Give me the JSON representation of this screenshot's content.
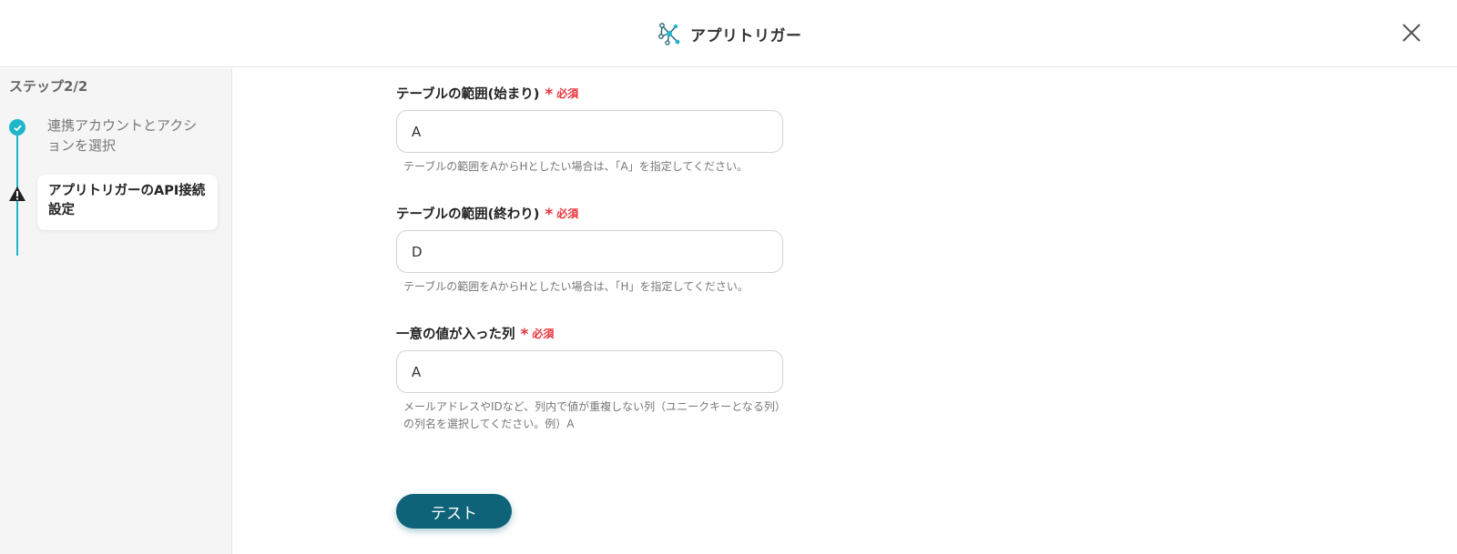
{
  "header": {
    "title": "アプリトリガー",
    "logo_icon": "network-nodes-icon",
    "close_icon": "close-icon"
  },
  "sidebar": {
    "step_counter": "ステップ2/2",
    "steps": [
      {
        "label": "連携アカウントとアクションを選択",
        "status": "completed",
        "icon": "check-circle-icon"
      },
      {
        "label": "アプリトリガーのAPI接続設定",
        "status": "warning",
        "icon": "warning-icon"
      }
    ]
  },
  "form": {
    "required_text": "必須",
    "fields": [
      {
        "label": "テーブルの範囲(始まり)",
        "value": "A",
        "help": "テーブルの範囲をAからHとしたい場合は、「A」を指定してください。"
      },
      {
        "label": "テーブルの範囲(終わり)",
        "value": "D",
        "help": "テーブルの範囲をAからHとしたい場合は、「H」を指定してください。"
      },
      {
        "label": "一意の値が入った列",
        "value": "A",
        "help": "メールアドレスやIDなど、列内で値が重複しない列（ユニークキーとなる列）の列名を選択してください。例）A"
      }
    ],
    "test_button": "テスト"
  },
  "colors": {
    "accent": "#1fb6c9",
    "primary_button": "#0f6378",
    "required": "#e8323c"
  }
}
